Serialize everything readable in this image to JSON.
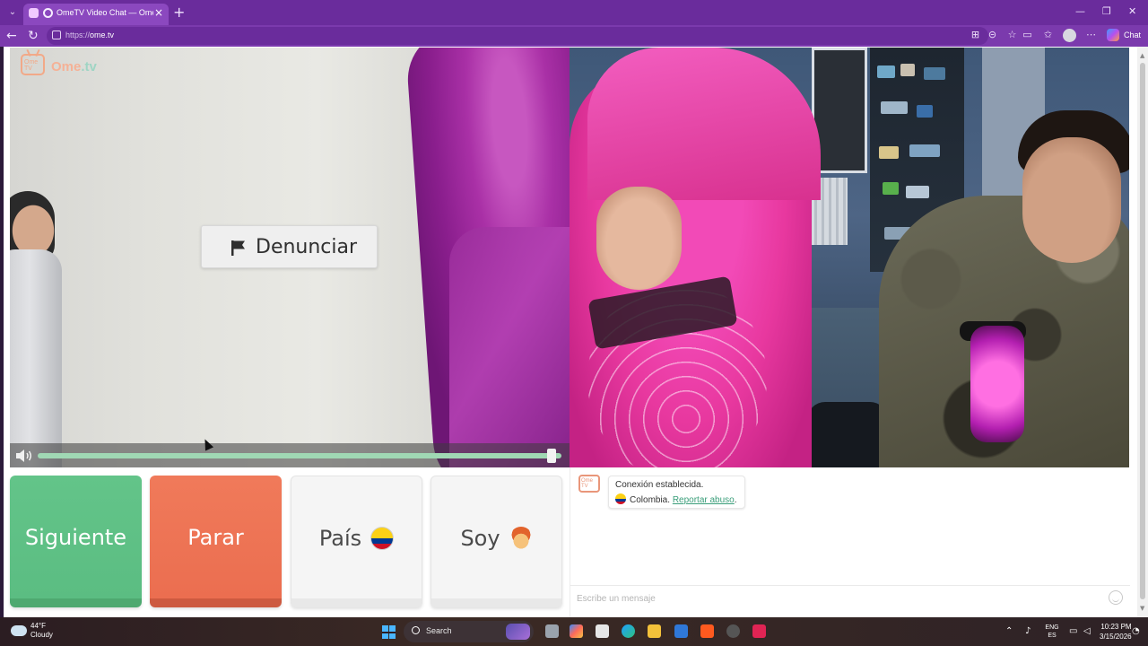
{
  "browser": {
    "tab_title": "OmeTV Video Chat — Omegle",
    "url_scheme": "https://",
    "url_host": "ome.tv",
    "copilot_label": "Chat"
  },
  "logo": {
    "tv_text": "Ome TV",
    "name": "Ome",
    "suffix": ".tv"
  },
  "video": {
    "report_button": "Denunciar",
    "volume_level": 0.99
  },
  "controls": {
    "next": "Siguiente",
    "stop": "Parar",
    "country": "País",
    "gender": "Soy"
  },
  "chat": {
    "system_line1": "Conexión establecida.",
    "country": "Colombia.",
    "report_link": "Reportar abuso",
    "report_link_period": ".",
    "input_placeholder": "Escribe un mensaje"
  },
  "taskbar": {
    "temperature": "44°F",
    "weather": "Cloudy",
    "search": "Search",
    "lang_top": "ENG",
    "lang_bottom": "ES",
    "time": "10:23 PM",
    "date": "3/15/2026"
  },
  "colors": {
    "browser_chrome": "#6a2c9c",
    "next_green": "#5bbd82",
    "stop_orange": "#eb6e50",
    "link_green": "#3a9e7a"
  }
}
